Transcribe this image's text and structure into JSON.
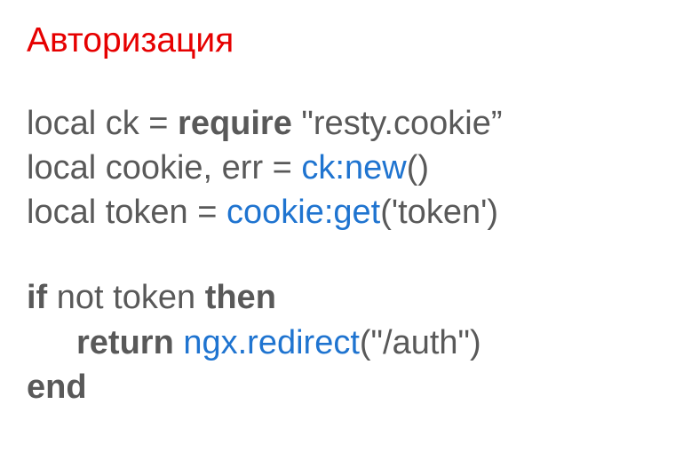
{
  "title": "Авторизация",
  "block1": {
    "l1_local_ck_eq": "local ck = ",
    "l1_require": "require",
    "l1_string": " \"resty.cookie”",
    "l2_prefix": "local cookie, err = ",
    "l2_call": "ck:new",
    "l2_suffix": "()",
    "l3_prefix": "local token = ",
    "l3_call": "cookie:get",
    "l3_suffix": "('token')"
  },
  "block2": {
    "l1_if": "if",
    "l1_mid": " not token ",
    "l1_then": "then",
    "l2_return": "return",
    "l2_call": " ngx.redirect",
    "l2_suffix": "(\"/auth\")",
    "l3_end": "end"
  }
}
